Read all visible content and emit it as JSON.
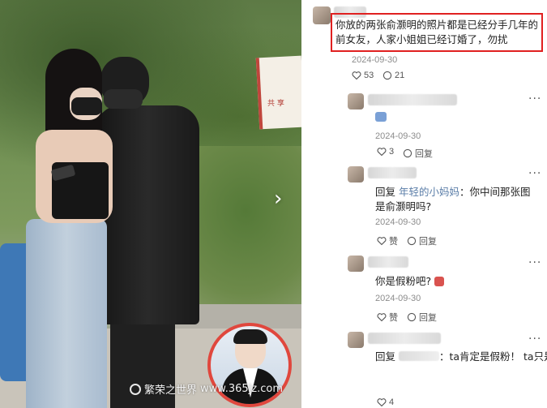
{
  "photo": {
    "sign_text": "共 享",
    "nav_arrow": "›"
  },
  "comments": [
    {
      "text": "你放的两张俞灏明的照片都是已经分手几年的前女友，人家小姐姐已经订婚了，勿扰",
      "date": "2024-09-30",
      "likes": "53",
      "replies": "21"
    },
    {
      "date": "2024-09-30",
      "likes": "3",
      "reply_label": "回复"
    },
    {
      "reply_prefix": "回复",
      "reply_to": "年轻的小妈妈",
      "text": "：你中间那张图是俞灏明吗?",
      "date": "2024-09-30",
      "like_label": "赞",
      "reply_label": "回复"
    },
    {
      "text": "你是假粉吧?",
      "date": "2024-09-30",
      "like_label": "赞",
      "reply_label": "回复"
    },
    {
      "reply_prefix": "回复",
      "text": "：ta肯定是假粉！ ta只是为",
      "likes": "4"
    }
  ],
  "watermark": {
    "text": "繁荣之世界",
    "url": "www.365jz.com"
  }
}
